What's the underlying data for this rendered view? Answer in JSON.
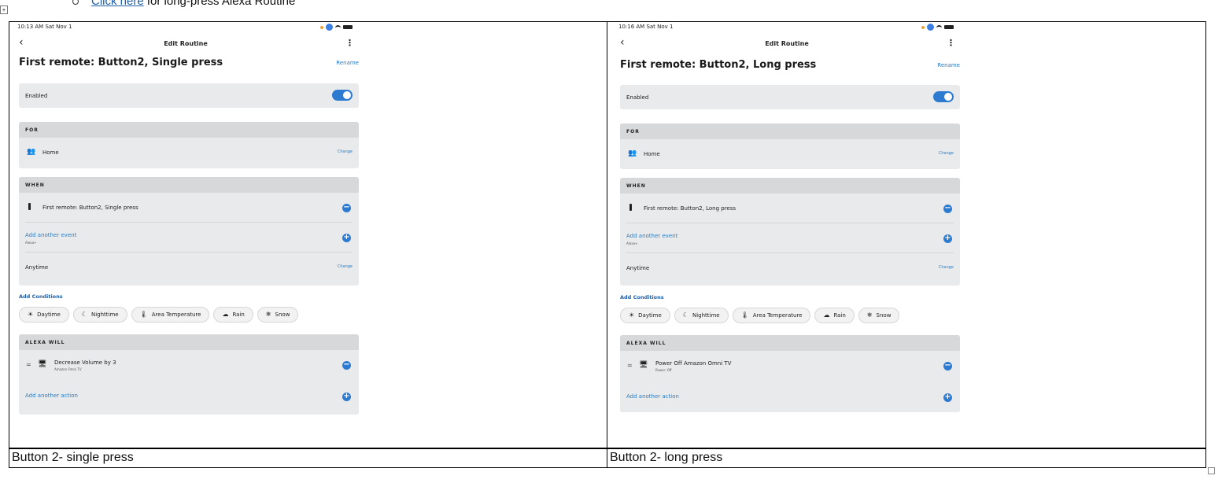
{
  "top_line": {
    "link_text": "Click here",
    "rest_text": " for long-press Alexa Routine"
  },
  "captions": [
    "Button 2- single press",
    "Button 2- long press"
  ],
  "screens": [
    {
      "status_time": "10:13 AM  Sat Nov 1",
      "nav_title": "Edit Routine",
      "back_icon": "‹",
      "routine_title": "First remote: Button2, Single press",
      "rename": "Rename",
      "enabled_label": "Enabled",
      "for_header": "FOR",
      "for_value": "Home",
      "change_label": "Change",
      "when_header": "WHEN",
      "when_event": "First remote: Button2, Single press",
      "add_event": "Add another event",
      "add_event_sub": "Alexa+",
      "anytime": "Anytime",
      "add_conditions": "Add Conditions",
      "chips": [
        "Daytime",
        "Nighttime",
        "Area Temperature",
        "Rain",
        "Snow"
      ],
      "alexa_header": "ALEXA WILL",
      "action": "Decrease Volume by 3",
      "action_sub": "Amazon Omni TV",
      "add_action": "Add another action"
    },
    {
      "status_time": "10:16 AM  Sat Nov 1",
      "nav_title": "Edit Routine",
      "back_icon": "‹",
      "routine_title": "First remote: Button2, Long press",
      "rename": "Rename",
      "enabled_label": "Enabled",
      "for_header": "FOR",
      "for_value": "Home",
      "change_label": "Change",
      "when_header": "WHEN",
      "when_event": "First remote: Button2, Long press",
      "add_event": "Add another event",
      "add_event_sub": "Alexa+",
      "anytime": "Anytime",
      "add_conditions": "Add Conditions",
      "chips": [
        "Daytime",
        "Nighttime",
        "Area Temperature",
        "Rain",
        "Snow"
      ],
      "alexa_header": "ALEXA WILL",
      "action": "Power Off Amazon Omni TV",
      "action_sub": "Power: Off",
      "add_action": "Add another action"
    }
  ],
  "chip_icons": [
    "☀",
    "☾",
    "🌡",
    "☁",
    "❄"
  ],
  "colors": {
    "accent": "#2d7bd0",
    "link": "#2a7dc8",
    "card_bg": "#e9eaeb",
    "card_head": "#d7d8da"
  }
}
